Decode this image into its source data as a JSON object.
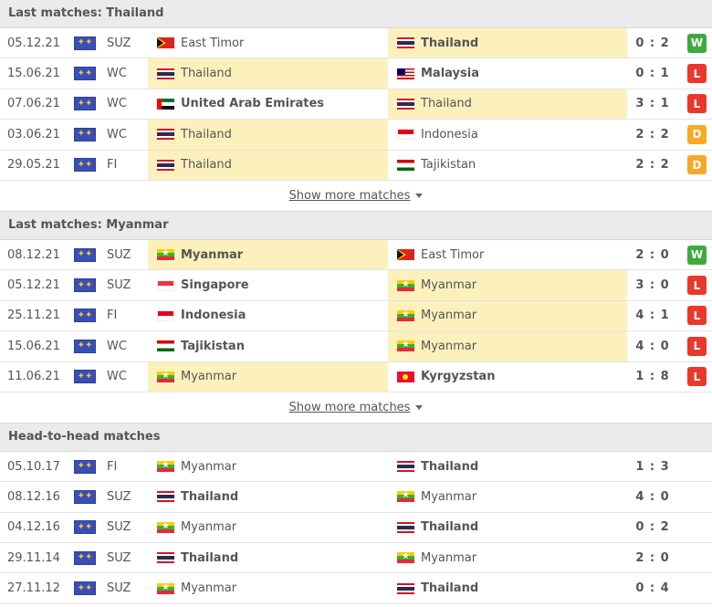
{
  "colors": {
    "win": "#3daa3d",
    "loss": "#e8392c",
    "draw": "#f7a928",
    "highlight": "#fcf1bd",
    "header_bg": "#ebebeb"
  },
  "sections": [
    {
      "title": "Last matches: Thailand",
      "show_more": "Show more matches",
      "matches": [
        {
          "date": "05.12.21",
          "comp": "SUZ",
          "home": "East Timor",
          "home_flag": "east-timor",
          "away": "Thailand",
          "away_flag": "thailand",
          "score": "0 : 2",
          "result": "W",
          "highlight": "away",
          "bold": "away"
        },
        {
          "date": "15.06.21",
          "comp": "WC",
          "home": "Thailand",
          "home_flag": "thailand",
          "away": "Malaysia",
          "away_flag": "malaysia",
          "score": "0 : 1",
          "result": "L",
          "highlight": "home",
          "bold": "away"
        },
        {
          "date": "07.06.21",
          "comp": "WC",
          "home": "United Arab Emirates",
          "home_flag": "uae",
          "away": "Thailand",
          "away_flag": "thailand",
          "score": "3 : 1",
          "result": "L",
          "highlight": "away",
          "bold": "home"
        },
        {
          "date": "03.06.21",
          "comp": "WC",
          "home": "Thailand",
          "home_flag": "thailand",
          "away": "Indonesia",
          "away_flag": "indonesia",
          "score": "2 : 2",
          "result": "D",
          "highlight": "home",
          "bold": "none"
        },
        {
          "date": "29.05.21",
          "comp": "FI",
          "home": "Thailand",
          "home_flag": "thailand",
          "away": "Tajikistan",
          "away_flag": "tajikistan",
          "score": "2 : 2",
          "result": "D",
          "highlight": "home",
          "bold": "none"
        }
      ]
    },
    {
      "title": "Last matches: Myanmar",
      "show_more": "Show more matches",
      "matches": [
        {
          "date": "08.12.21",
          "comp": "SUZ",
          "home": "Myanmar",
          "home_flag": "myanmar",
          "away": "East Timor",
          "away_flag": "east-timor",
          "score": "2 : 0",
          "result": "W",
          "highlight": "home",
          "bold": "home"
        },
        {
          "date": "05.12.21",
          "comp": "SUZ",
          "home": "Singapore",
          "home_flag": "singapore",
          "away": "Myanmar",
          "away_flag": "myanmar",
          "score": "3 : 0",
          "result": "L",
          "highlight": "away",
          "bold": "home"
        },
        {
          "date": "25.11.21",
          "comp": "FI",
          "home": "Indonesia",
          "home_flag": "indonesia",
          "away": "Myanmar",
          "away_flag": "myanmar",
          "score": "4 : 1",
          "result": "L",
          "highlight": "away",
          "bold": "home"
        },
        {
          "date": "15.06.21",
          "comp": "WC",
          "home": "Tajikistan",
          "home_flag": "tajikistan",
          "away": "Myanmar",
          "away_flag": "myanmar",
          "score": "4 : 0",
          "result": "L",
          "highlight": "away",
          "bold": "home"
        },
        {
          "date": "11.06.21",
          "comp": "WC",
          "home": "Myanmar",
          "home_flag": "myanmar",
          "away": "Kyrgyzstan",
          "away_flag": "kyrgyzstan",
          "score": "1 : 8",
          "result": "L",
          "highlight": "home",
          "bold": "away"
        }
      ]
    },
    {
      "title": "Head-to-head matches",
      "matches": [
        {
          "date": "05.10.17",
          "comp": "FI",
          "home": "Myanmar",
          "home_flag": "myanmar",
          "away": "Thailand",
          "away_flag": "thailand",
          "score": "1 : 3",
          "result": "",
          "highlight": "none",
          "bold": "away"
        },
        {
          "date": "08.12.16",
          "comp": "SUZ",
          "home": "Thailand",
          "home_flag": "thailand",
          "away": "Myanmar",
          "away_flag": "myanmar",
          "score": "4 : 0",
          "result": "",
          "highlight": "none",
          "bold": "home"
        },
        {
          "date": "04.12.16",
          "comp": "SUZ",
          "home": "Myanmar",
          "home_flag": "myanmar",
          "away": "Thailand",
          "away_flag": "thailand",
          "score": "0 : 2",
          "result": "",
          "highlight": "none",
          "bold": "away"
        },
        {
          "date": "29.11.14",
          "comp": "SUZ",
          "home": "Thailand",
          "home_flag": "thailand",
          "away": "Myanmar",
          "away_flag": "myanmar",
          "score": "2 : 0",
          "result": "",
          "highlight": "none",
          "bold": "home"
        },
        {
          "date": "27.11.12",
          "comp": "SUZ",
          "home": "Myanmar",
          "home_flag": "myanmar",
          "away": "Thailand",
          "away_flag": "thailand",
          "score": "0 : 4",
          "result": "",
          "highlight": "none",
          "bold": "away"
        }
      ]
    }
  ]
}
